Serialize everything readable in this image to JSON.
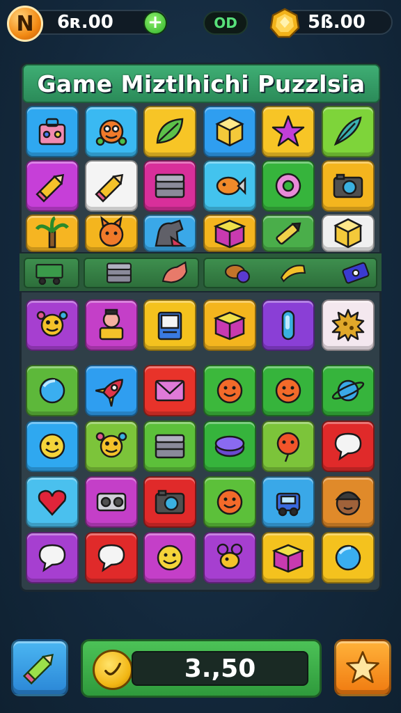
{
  "hud": {
    "coins_label": "N",
    "coins_value": "6ʀ.00",
    "add_label": "+",
    "mid_badge": "OD",
    "gems_value": "5ß.00"
  },
  "board": {
    "title": "Game Miztlhichi Puzzlsia"
  },
  "score": {
    "value": "3.,50"
  },
  "tiles": [
    {
      "row": 0,
      "col": 0,
      "color": "#2fa8f0",
      "icon": "bag-icon"
    },
    {
      "row": 0,
      "col": 1,
      "color": "#3ab9f2",
      "icon": "monster-icon"
    },
    {
      "row": 0,
      "col": 2,
      "color": "#f7c526",
      "icon": "leaf-icon"
    },
    {
      "row": 0,
      "col": 3,
      "color": "#2f9ef0",
      "icon": "cube-icon"
    },
    {
      "row": 0,
      "col": 4,
      "color": "#f7c526",
      "icon": "star-icon"
    },
    {
      "row": 0,
      "col": 5,
      "color": "#7ed43a",
      "icon": "feather-icon"
    },
    {
      "row": 1,
      "col": 0,
      "color": "#c63fd8",
      "icon": "pencil-icon"
    },
    {
      "row": 1,
      "col": 1,
      "color": "#f4f4f4",
      "icon": "pencil-icon"
    },
    {
      "row": 1,
      "col": 2,
      "color": "#d82f9a",
      "icon": "chest-icon"
    },
    {
      "row": 1,
      "col": 3,
      "color": "#43c3ee",
      "icon": "fish-icon"
    },
    {
      "row": 1,
      "col": 4,
      "color": "#36b43c",
      "icon": "donut-icon"
    },
    {
      "row": 1,
      "col": 5,
      "color": "#f4b51e",
      "icon": "camera-icon"
    },
    {
      "row": 2,
      "col": 0,
      "color": "#f6b522",
      "icon": "palm-icon"
    },
    {
      "row": 2,
      "col": 1,
      "color": "#f4b51e",
      "icon": "cat-icon"
    },
    {
      "row": 2,
      "col": 2,
      "color": "#3aa8e8",
      "icon": "dog-icon"
    },
    {
      "row": 2,
      "col": 3,
      "color": "#f4b51e",
      "icon": "box-icon"
    },
    {
      "row": 2,
      "col": 4,
      "color": "#4aae4a",
      "icon": "pen-icon"
    },
    {
      "row": 2,
      "col": 5,
      "color": "#f0f0f0",
      "icon": "cube-icon"
    },
    {
      "row": 3,
      "col": 0,
      "color": "#a63fd0",
      "icon": "creature-icon"
    },
    {
      "row": 3,
      "col": 1,
      "color": "#c43fc8",
      "icon": "doll-icon"
    },
    {
      "row": 3,
      "col": 2,
      "color": "#f4c21e",
      "icon": "book-icon"
    },
    {
      "row": 3,
      "col": 3,
      "color": "#f4b51e",
      "icon": "box-icon"
    },
    {
      "row": 3,
      "col": 4,
      "color": "#8a3fd6",
      "icon": "tube-icon"
    },
    {
      "row": 3,
      "col": 5,
      "color": "#f4e8ef",
      "icon": "spiky-ball-icon"
    },
    {
      "row": 4,
      "col": 0,
      "color": "#5db83a",
      "icon": "ball-icon"
    },
    {
      "row": 4,
      "col": 1,
      "color": "#2f9ef0",
      "icon": "rocket-icon"
    },
    {
      "row": 4,
      "col": 2,
      "color": "#e8332a",
      "icon": "envelope-icon"
    },
    {
      "row": 4,
      "col": 3,
      "color": "#3cb83c",
      "icon": "face-icon"
    },
    {
      "row": 4,
      "col": 4,
      "color": "#36b43c",
      "icon": "face-icon"
    },
    {
      "row": 4,
      "col": 5,
      "color": "#36b43c",
      "icon": "planet-icon"
    },
    {
      "row": 5,
      "col": 0,
      "color": "#2fa8f0",
      "icon": "smiley-icon"
    },
    {
      "row": 5,
      "col": 1,
      "color": "#7cc43a",
      "icon": "creature-icon"
    },
    {
      "row": 5,
      "col": 2,
      "color": "#5cc03a",
      "icon": "chest-icon"
    },
    {
      "row": 5,
      "col": 3,
      "color": "#36b43c",
      "icon": "disc-icon"
    },
    {
      "row": 5,
      "col": 4,
      "color": "#7cc43a",
      "icon": "balloon-icon"
    },
    {
      "row": 5,
      "col": 5,
      "color": "#e02a2a",
      "icon": "chat-icon"
    },
    {
      "row": 6,
      "col": 0,
      "color": "#4ac0ee",
      "icon": "heart-icon"
    },
    {
      "row": 6,
      "col": 1,
      "color": "#c43fc8",
      "icon": "speaker-icon"
    },
    {
      "row": 6,
      "col": 2,
      "color": "#e02a2a",
      "icon": "camera-icon"
    },
    {
      "row": 6,
      "col": 3,
      "color": "#5cc03a",
      "icon": "face-icon"
    },
    {
      "row": 6,
      "col": 4,
      "color": "#3aa8e8",
      "icon": "robot-icon"
    },
    {
      "row": 6,
      "col": 5,
      "color": "#e08a2a",
      "icon": "avatar-icon"
    },
    {
      "row": 7,
      "col": 0,
      "color": "#a63fd0",
      "icon": "chat-icon"
    },
    {
      "row": 7,
      "col": 1,
      "color": "#e02a2a",
      "icon": "chat-icon"
    },
    {
      "row": 7,
      "col": 2,
      "color": "#c43fc8",
      "icon": "smiley-icon"
    },
    {
      "row": 7,
      "col": 3,
      "color": "#a63fd0",
      "icon": "bee-icon"
    },
    {
      "row": 7,
      "col": 4,
      "color": "#f4c21e",
      "icon": "box-icon"
    },
    {
      "row": 7,
      "col": 5,
      "color": "#f4c21e",
      "icon": "ball-icon"
    }
  ],
  "tray_items": [
    {
      "icon": "cart-icon"
    },
    {
      "icon": "chest-icon"
    },
    {
      "icon": "fox-icon"
    },
    {
      "icon": "berry-icon"
    },
    {
      "icon": "horn-icon"
    },
    {
      "icon": "ticket-icon"
    }
  ],
  "colors": {
    "accent_green": "#3fae74",
    "gold": "#f7c526",
    "background": "#13283c"
  }
}
